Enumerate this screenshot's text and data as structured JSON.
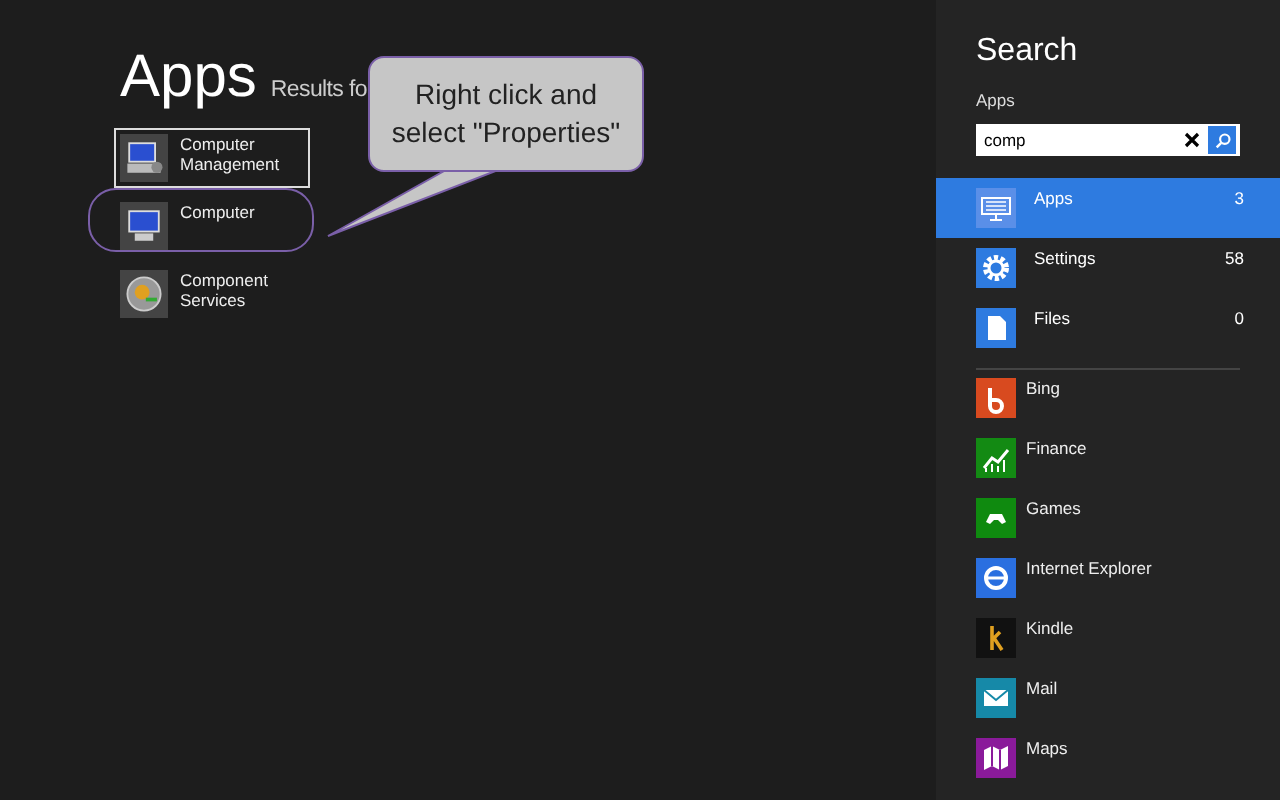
{
  "results": {
    "title": "Apps",
    "subtitle": "Results fo",
    "items": [
      {
        "label": "Computer Management",
        "kind": "management",
        "selected": true,
        "highlighted": false
      },
      {
        "label": "Computer",
        "kind": "computer",
        "selected": false,
        "highlighted": true
      },
      {
        "label": "Component Services",
        "kind": "services",
        "selected": false,
        "highlighted": false
      }
    ]
  },
  "callout": {
    "text": "Right click and select \"Properties\""
  },
  "search": {
    "title": "Search",
    "scope": "Apps",
    "query": "comp",
    "categories": [
      {
        "label": "Apps",
        "count": "3",
        "kind": "apps",
        "selected": true
      },
      {
        "label": "Settings",
        "count": "58",
        "kind": "settings",
        "selected": false
      },
      {
        "label": "Files",
        "count": "0",
        "kind": "files",
        "selected": false
      }
    ],
    "apps": [
      {
        "label": "Bing",
        "kind": "bing",
        "color": "#d84a1f"
      },
      {
        "label": "Finance",
        "kind": "finance",
        "color": "#138a13"
      },
      {
        "label": "Games",
        "kind": "games",
        "color": "#0f8a0f"
      },
      {
        "label": "Internet Explorer",
        "kind": "ie",
        "color": "#2a6fe0"
      },
      {
        "label": "Kindle",
        "kind": "kindle",
        "color": "#111111"
      },
      {
        "label": "Mail",
        "kind": "mail",
        "color": "#1689a8"
      },
      {
        "label": "Maps",
        "kind": "maps",
        "color": "#8a1a9a"
      }
    ]
  }
}
